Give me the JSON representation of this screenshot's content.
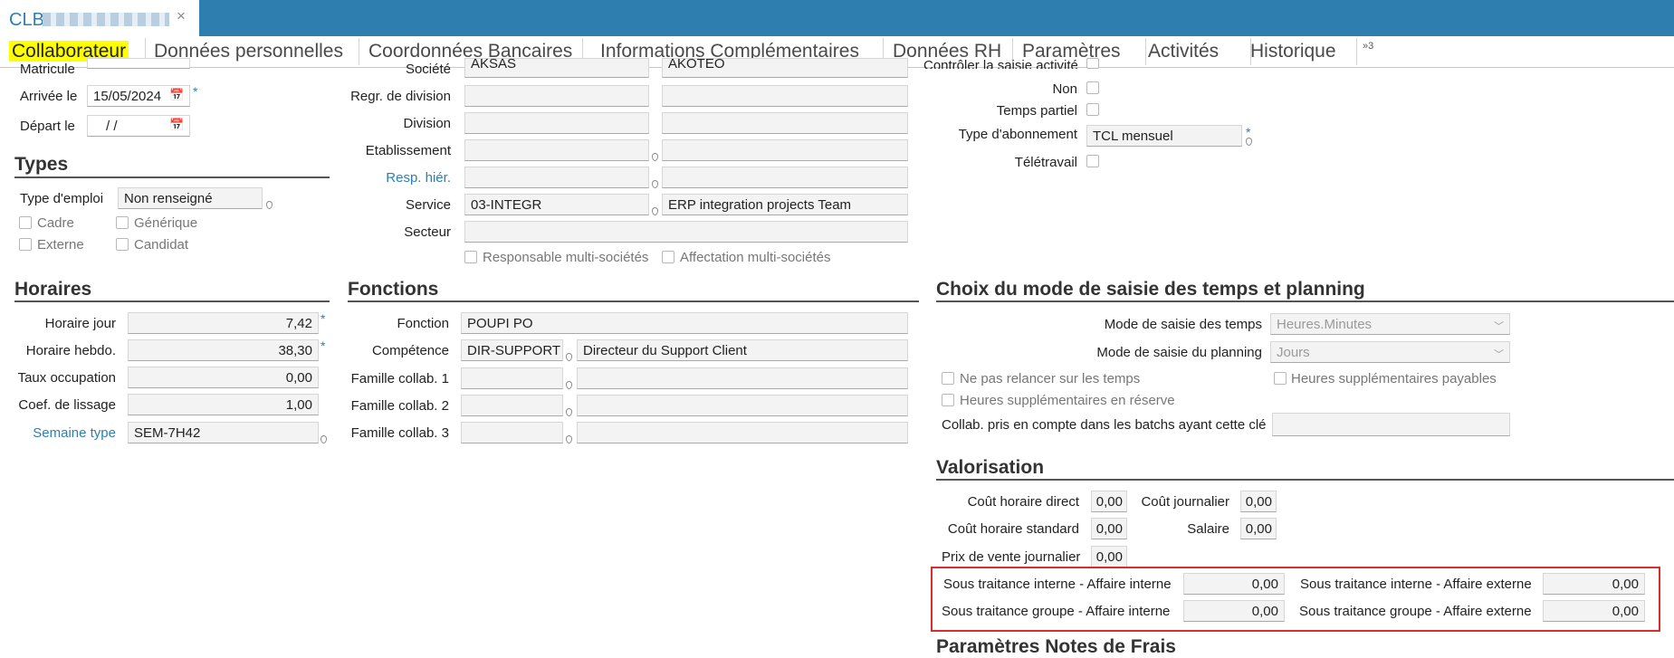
{
  "window": {
    "title": "CLB",
    "close": "×"
  },
  "tabs": [
    "Collaborateur",
    "Données personnelles",
    "Coordonnées Bancaires",
    "Informations Complémentaires",
    "Données RH",
    "Paramètres",
    "Activités",
    "Historique"
  ],
  "tabs_more": "»3",
  "identity": {
    "matricule_label": "Matricule",
    "arrivee_label": "Arrivée le",
    "arrivee_value": "15/05/2024",
    "depart_label": "Départ le",
    "depart_value": "/   /"
  },
  "types": {
    "title": "Types",
    "type_emploi_label": "Type d'emploi",
    "type_emploi_value": "Non renseigné",
    "cadre": "Cadre",
    "generique": "Générique",
    "externe": "Externe",
    "candidat": "Candidat"
  },
  "societe": {
    "societe_label": "Société",
    "societe_code": "AKSAS",
    "societe_name": "AKOTEO",
    "regr_division_label": "Regr. de division",
    "division_label": "Division",
    "etablissement_label": "Etablissement",
    "resp_hier_label": "Resp. hiér.",
    "service_label": "Service",
    "service_code": "03-INTEGR",
    "service_name": "ERP integration projects Team",
    "secteur_label": "Secteur",
    "resp_multi": "Responsable multi-sociétés",
    "affect_multi": "Affectation multi-sociétés"
  },
  "right_top": {
    "controler_label": "Contrôler la saisie activité",
    "non_label": "Non",
    "temps_partiel_label": "Temps partiel",
    "abonnement_label": "Type d'abonnement",
    "abonnement_value": "TCL mensuel",
    "teletravail_label": "Télétravail"
  },
  "horaires": {
    "title": "Horaires",
    "jour_label": "Horaire jour",
    "jour_value": "7,42",
    "hebdo_label": "Horaire hebdo.",
    "hebdo_value": "38,30",
    "taux_label": "Taux occupation",
    "taux_value": "0,00",
    "coef_label": "Coef. de lissage",
    "coef_value": "1,00",
    "semaine_label": "Semaine type",
    "semaine_value": "SEM-7H42"
  },
  "fonctions": {
    "title": "Fonctions",
    "fonction_label": "Fonction",
    "fonction_value": "POUPI PO",
    "competence_label": "Compétence",
    "competence_code": "DIR-SUPPORT",
    "competence_name": "Directeur du Support Client",
    "famille1_label": "Famille collab. 1",
    "famille2_label": "Famille collab. 2",
    "famille3_label": "Famille collab. 3"
  },
  "saisie": {
    "title": "Choix du mode de saisie des temps et planning",
    "temps_label": "Mode de saisie des temps",
    "temps_value": "Heures.Minutes",
    "planning_label": "Mode de saisie du planning",
    "planning_value": "Jours",
    "relancer": "Ne pas relancer sur les temps",
    "heures_payables": "Heures supplémentaires payables",
    "heures_reserve": "Heures supplémentaires en réserve",
    "batch_label": "Collab. pris en compte dans les batchs ayant cette clé"
  },
  "valorisation": {
    "title": "Valorisation",
    "cout_direct_label": "Coût horaire direct",
    "cout_direct_value": "0,00",
    "cout_journalier_label": "Coût journalier",
    "cout_journalier_value": "0,00",
    "cout_standard_label": "Coût horaire standard",
    "cout_standard_value": "0,00",
    "salaire_label": "Salaire",
    "salaire_value": "0,00",
    "prix_vente_label": "Prix de vente journalier",
    "prix_vente_value": "0,00",
    "sti_ai_label": "Sous traitance interne - Affaire interne",
    "sti_ai_value": "0,00",
    "sti_ae_label": "Sous traitance interne - Affaire externe",
    "sti_ae_value": "0,00",
    "stg_ai_label": "Sous traitance groupe - Affaire interne",
    "stg_ai_value": "0,00",
    "stg_ae_label": "Sous traitance groupe - Affaire externe",
    "stg_ae_value": "0,00"
  },
  "notes_frais": {
    "title": "Paramètres Notes de Frais"
  }
}
